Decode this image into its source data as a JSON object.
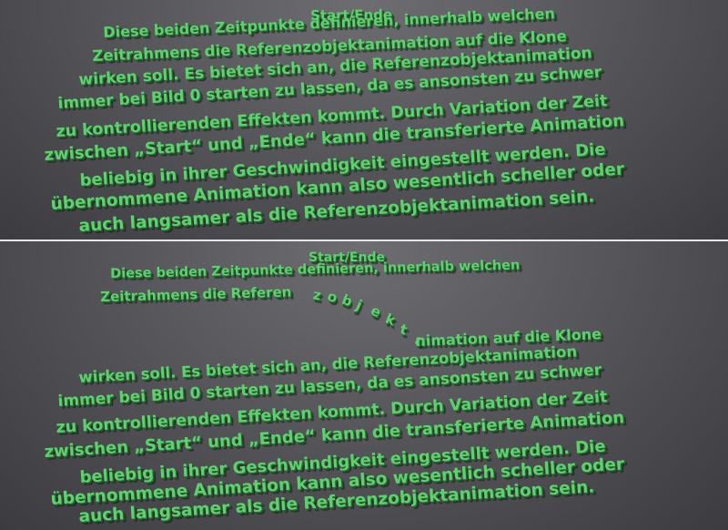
{
  "top": {
    "title": "Start/Ende",
    "lines": [
      "Diese beiden Zeitpunkte definieren, innerhalb welchen",
      "Zeitrahmens die Referenzobjektanimation auf die Klone",
      "wirken soll. Es bietet sich an, die Referenzobjektanimation",
      "immer bei Bild 0 starten zu lassen, da es ansonsten zu schwer",
      "zu kontrollierenden Effekten kommt. Durch Variation der Zeit",
      "zwischen „Start“ und „Ende“ kann die transferierte Animation",
      "beliebig in ihrer Geschwindigkeit eingestellt werden. Die",
      "übernommene Animation kann also wesentlich scheller oder",
      "auch langsamer als die Referenzobjektanimation sein."
    ]
  },
  "bottom": {
    "title": "Start/Ende",
    "line1": "Diese beiden Zeitpunkte definieren, innerhalb welchen",
    "line2_start": "Zeitrahmens die Referen",
    "line2_wave": "zobjekta",
    "line2_end": "nimation auf die Klone",
    "lines": [
      "wirken soll. Es bietet sich an, die Referenzobjektanimation",
      "immer bei Bild 0 starten zu lassen, da es ansonsten zu schwer",
      "zu kontrollierenden Effekten kommt. Durch Variation der Zeit",
      "zwischen „Start“ und „Ende“ kann die transferierte Animation",
      "beliebig in ihrer Geschwindigkeit eingestellt werden. Die",
      "übernommene Animation kann also wesentlich scheller oder",
      "auch langsamer als die Referenzobjektanimation sein."
    ]
  }
}
